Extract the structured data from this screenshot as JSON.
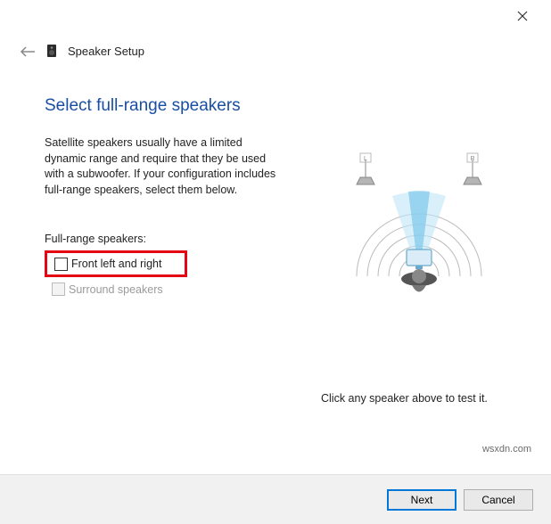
{
  "window": {
    "title": "Speaker Setup"
  },
  "content": {
    "heading": "Select full-range speakers",
    "description": "Satellite speakers usually have a limited dynamic range and require that they be used with a subwoofer.  If your configuration includes full-range speakers, select them below.",
    "subheading": "Full-range speakers:",
    "options": {
      "front": "Front left and right",
      "surround": "Surround speakers"
    },
    "test_hint": "Click any speaker above to test it."
  },
  "diagram": {
    "left_label": "L",
    "right_label": "R"
  },
  "buttons": {
    "next": "Next",
    "cancel": "Cancel"
  },
  "watermark": "wsxdn.com"
}
